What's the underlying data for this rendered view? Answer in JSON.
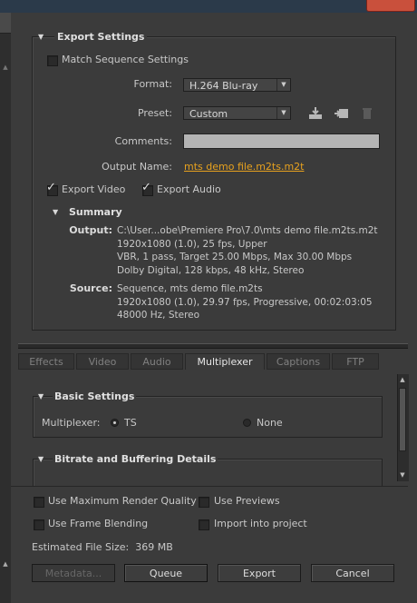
{
  "export_settings": {
    "title": "Export Settings",
    "match_sequence": "Match Sequence Settings",
    "format_label": "Format:",
    "format_value": "H.264 Blu-ray",
    "preset_label": "Preset:",
    "preset_value": "Custom",
    "comments_label": "Comments:",
    "comments_value": "",
    "output_name_label": "Output Name:",
    "output_name_value": "mts demo file.m2ts.m2t",
    "export_video": "Export Video",
    "export_audio": "Export Audio",
    "export_video_checked": true,
    "export_audio_checked": true
  },
  "summary": {
    "title": "Summary",
    "output_key": "Output:",
    "output_lines": [
      "C:\\User...obe\\Premiere Pro\\7.0\\mts demo file.m2ts.m2t",
      "1920x1080 (1.0), 25 fps, Upper",
      "VBR, 1 pass, Target 25.00 Mbps, Max 30.00 Mbps",
      "Dolby Digital, 128 kbps, 48 kHz, Stereo"
    ],
    "source_key": "Source:",
    "source_lines": [
      "Sequence, mts demo file.m2ts",
      "1920x1080 (1.0), 29.97 fps, Progressive, 00:02:03:05",
      "48000 Hz, Stereo"
    ]
  },
  "tabs": [
    "Effects",
    "Video",
    "Audio",
    "Multiplexer",
    "Captions",
    "FTP"
  ],
  "active_tab": "Multiplexer",
  "basic_settings": {
    "title": "Basic Settings",
    "multiplexer_label": "Multiplexer:",
    "option_ts": "TS",
    "option_none": "None",
    "selected": "TS"
  },
  "bitrate": {
    "title": "Bitrate and Buffering Details"
  },
  "bottom": {
    "max_render_quality": "Use Maximum Render Quality",
    "use_previews": "Use Previews",
    "frame_blending": "Use Frame Blending",
    "import_into_project": "Import into project",
    "estimated_size": "Estimated File Size:  369 MB"
  },
  "buttons": {
    "metadata": "Metadata...",
    "queue": "Queue",
    "export": "Export",
    "cancel": "Cancel"
  },
  "colors": {
    "background": "#3b3b3b",
    "link": "#e8a21e",
    "close_button": "#c9503c"
  },
  "icons": [
    "triangle-down-icon",
    "save-preset-icon",
    "import-preset-icon",
    "delete-preset-icon",
    "checkmark-icon",
    "dropdown-arrow-icon",
    "scroll-up-icon",
    "scroll-down-icon"
  ]
}
